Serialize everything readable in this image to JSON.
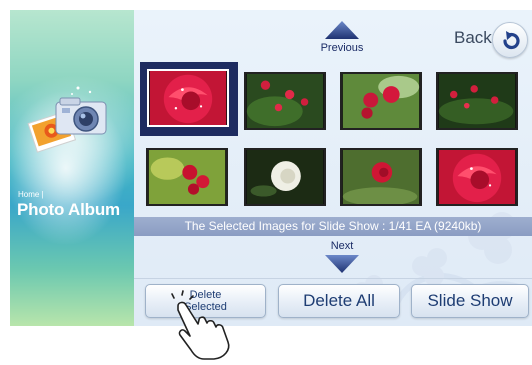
{
  "sidebar": {
    "breadcrumb": "Home |",
    "title": "Photo Album",
    "icon": "camera-with-photo-icon"
  },
  "navigation": {
    "previous_label": "Previous",
    "next_label": "Next",
    "back_label": "Back",
    "back_icon": "rotate-back-icon"
  },
  "thumbnails": [
    {
      "subject": "red rose close-up",
      "selected": true
    },
    {
      "subject": "red roses on bush",
      "selected": false
    },
    {
      "subject": "red roses bloom",
      "selected": false
    },
    {
      "subject": "red roses garden",
      "selected": false
    },
    {
      "subject": "red roses cluster",
      "selected": false
    },
    {
      "subject": "white rose",
      "selected": false
    },
    {
      "subject": "single red rose",
      "selected": false
    },
    {
      "subject": "red rose close-up",
      "selected": false
    }
  ],
  "status": {
    "text": "The Selected Images for Slide Show : 1/41 EA (9240kb)"
  },
  "buttons": {
    "delete_selected_line1": "Delete",
    "delete_selected_line2": "Selected",
    "delete_all": "Delete All",
    "slide_show": "Slide Show"
  },
  "overlay": {
    "icon": "pointing-hand-icon"
  },
  "colors": {
    "accent_navy": "#1e2c60",
    "arrow_blue": "#2f4a8c",
    "status_bar": "#8a9cc2",
    "button_text": "#1e3d73"
  }
}
